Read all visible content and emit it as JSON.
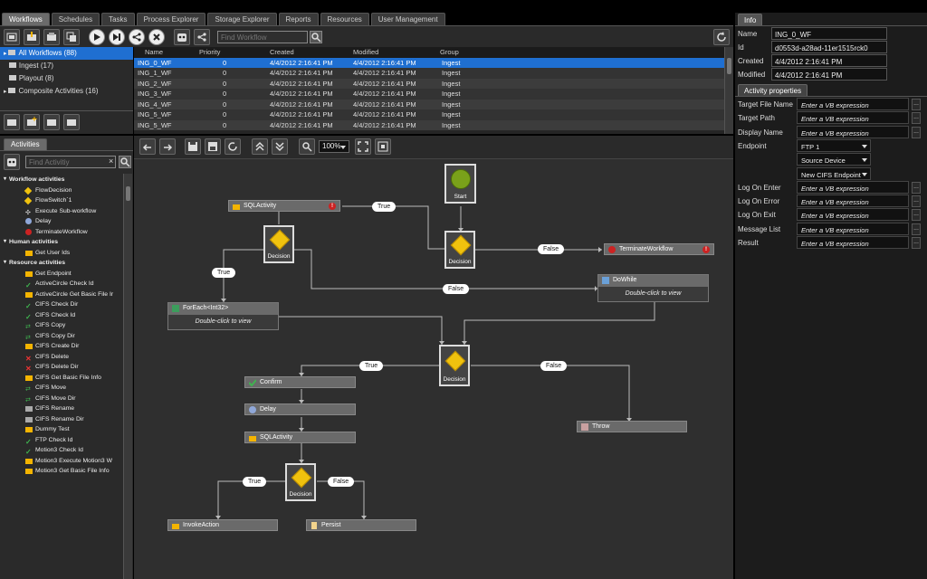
{
  "tabs": [
    "Workflows",
    "Schedules",
    "Tasks",
    "Process Explorer",
    "Storage Explorer",
    "Reports",
    "Resources",
    "User Management"
  ],
  "workflow_search": {
    "placeholder": "Find Workflow"
  },
  "tree": [
    {
      "label": "All Workflows (88)",
      "selected": true
    },
    {
      "label": "Ingest (17)"
    },
    {
      "label": "Playout (8)"
    },
    {
      "label": "Composite Activities (16)"
    }
  ],
  "grid": {
    "columns": [
      "Name",
      "Priority",
      "Created",
      "Modified",
      "Group"
    ],
    "rows": [
      [
        "ING_0_WF",
        "0",
        "4/4/2012 2:16:41 PM",
        "4/4/2012 2:16:41 PM",
        "Ingest"
      ],
      [
        "ING_1_WF",
        "0",
        "4/4/2012 2:16:41 PM",
        "4/4/2012 2:16:41 PM",
        "Ingest"
      ],
      [
        "ING_2_WF",
        "0",
        "4/4/2012 2:16:41 PM",
        "4/4/2012 2:16:41 PM",
        "Ingest"
      ],
      [
        "ING_3_WF",
        "0",
        "4/4/2012 2:16:41 PM",
        "4/4/2012 2:16:41 PM",
        "Ingest"
      ],
      [
        "ING_4_WF",
        "0",
        "4/4/2012 2:16:41 PM",
        "4/4/2012 2:16:41 PM",
        "Ingest"
      ],
      [
        "ING_5_WF",
        "0",
        "4/4/2012 2:16:41 PM",
        "4/4/2012 2:16:41 PM",
        "Ingest"
      ],
      [
        "ING_5_WF",
        "0",
        "4/4/2012 2:16:41 PM",
        "4/4/2012 2:16:41 PM",
        "Ingest"
      ]
    ]
  },
  "activities": {
    "tab": "Activities",
    "search_placeholder": "Find Activitiy",
    "clear": "×",
    "groups": [
      {
        "title": "Workflow activities",
        "items": [
          {
            "label": "FlowDecision",
            "icon": "decision-icon"
          },
          {
            "label": "FlowSwitch`1",
            "icon": "switch-icon"
          },
          {
            "label": "Execute Sub-workflow",
            "icon": "execute-icon"
          },
          {
            "label": "Delay",
            "icon": "delay-icon"
          },
          {
            "label": "TerminateWorkflow",
            "icon": "terminate-icon"
          }
        ]
      },
      {
        "title": "Human activities",
        "items": [
          {
            "label": "Get User Ids",
            "icon": "folder-icon"
          }
        ]
      },
      {
        "title": "Resource activities",
        "items": [
          {
            "label": "Get Endpoint",
            "icon": "folder-icon"
          },
          {
            "label": "ActiveCircle Check Id",
            "icon": "check-icon"
          },
          {
            "label": "ActiveCircle Get Basic File Ir",
            "icon": "folder-icon"
          },
          {
            "label": "CIFS Check Dir",
            "icon": "check-icon"
          },
          {
            "label": "CIFS Check Id",
            "icon": "check-icon"
          },
          {
            "label": "CIFS Copy",
            "icon": "copy-icon"
          },
          {
            "label": "CIFS Copy Dir",
            "icon": "copy-icon"
          },
          {
            "label": "CIFS Create Dir",
            "icon": "folder-icon"
          },
          {
            "label": "CIFS Delete",
            "icon": "delete-icon"
          },
          {
            "label": "CIFS Delete Dir",
            "icon": "delete-icon"
          },
          {
            "label": "CIFS Get Basic File Info",
            "icon": "folder-icon"
          },
          {
            "label": "CIFS Move",
            "icon": "copy-icon"
          },
          {
            "label": "CIFS Move Dir",
            "icon": "copy-icon"
          },
          {
            "label": "CIFS Rename",
            "icon": "rename-icon"
          },
          {
            "label": "CIFS Rename Dir",
            "icon": "rename-icon"
          },
          {
            "label": "Dummy Test",
            "icon": "folder-icon"
          },
          {
            "label": "FTP Check Id",
            "icon": "check-icon"
          },
          {
            "label": "Motion3 Check Id",
            "icon": "check-icon"
          },
          {
            "label": "Motion3 Execute Motion3 W",
            "icon": "folder-icon"
          },
          {
            "label": "Motion3 Get Basic File Info",
            "icon": "folder-icon"
          }
        ]
      }
    ]
  },
  "zoom": "100%",
  "canvas": {
    "start": "Start",
    "sql1": "SQLActivity",
    "decision": "Decision",
    "terminate": "TerminateWorkflow",
    "dowhile": "DoWhile",
    "dowhile_body": "Double-click to view",
    "foreach": "ForEach<Int32>",
    "foreach_body": "Double-click to view",
    "confirm": "Confirm",
    "delay": "Delay",
    "sql2": "SQLActivity",
    "throw": "Throw",
    "invoke": "InvokeAction",
    "persist": "Persist",
    "true": "True",
    "false": "False",
    "error_mark": "!"
  },
  "info": {
    "tab": "Info",
    "fields": [
      {
        "key": "Name",
        "value": "ING_0_WF"
      },
      {
        "key": "Id",
        "value": "d0553d-a28ad-11er1515rck0"
      },
      {
        "key": "Created",
        "value": "4/4/2012 2:16:41 PM"
      },
      {
        "key": "Modified",
        "value": "4/4/2012 2:16:41 PM"
      }
    ]
  },
  "activity_properties": {
    "tab": "Activity properties",
    "props": [
      {
        "key": "Target File Name",
        "value": "Enter a VB expression",
        "type": "expr"
      },
      {
        "key": "Target Path",
        "value": "Enter a VB expression",
        "type": "expr"
      },
      {
        "key": "Display Name",
        "value": "Enter a VB expression",
        "type": "expr"
      },
      {
        "key": "Endpoint",
        "value": "FTP 1",
        "type": "dropdown"
      },
      {
        "key": "",
        "value": "Source Device",
        "type": "dropdown"
      },
      {
        "key": "",
        "value": "New CIFS Endpoint",
        "type": "dropdown"
      },
      {
        "key": "Log On Enter",
        "value": "Enter a VB expression",
        "type": "expr"
      },
      {
        "key": "Log On Error",
        "value": "Enter a VB expression",
        "type": "expr"
      },
      {
        "key": "Log On Exit",
        "value": "Enter a VB expression",
        "type": "expr"
      },
      {
        "key": "Message List",
        "value": "Enter a VB expression",
        "type": "expr"
      },
      {
        "key": "Result",
        "value": "Enter a VB expression",
        "type": "expr"
      }
    ],
    "dots": "..."
  }
}
